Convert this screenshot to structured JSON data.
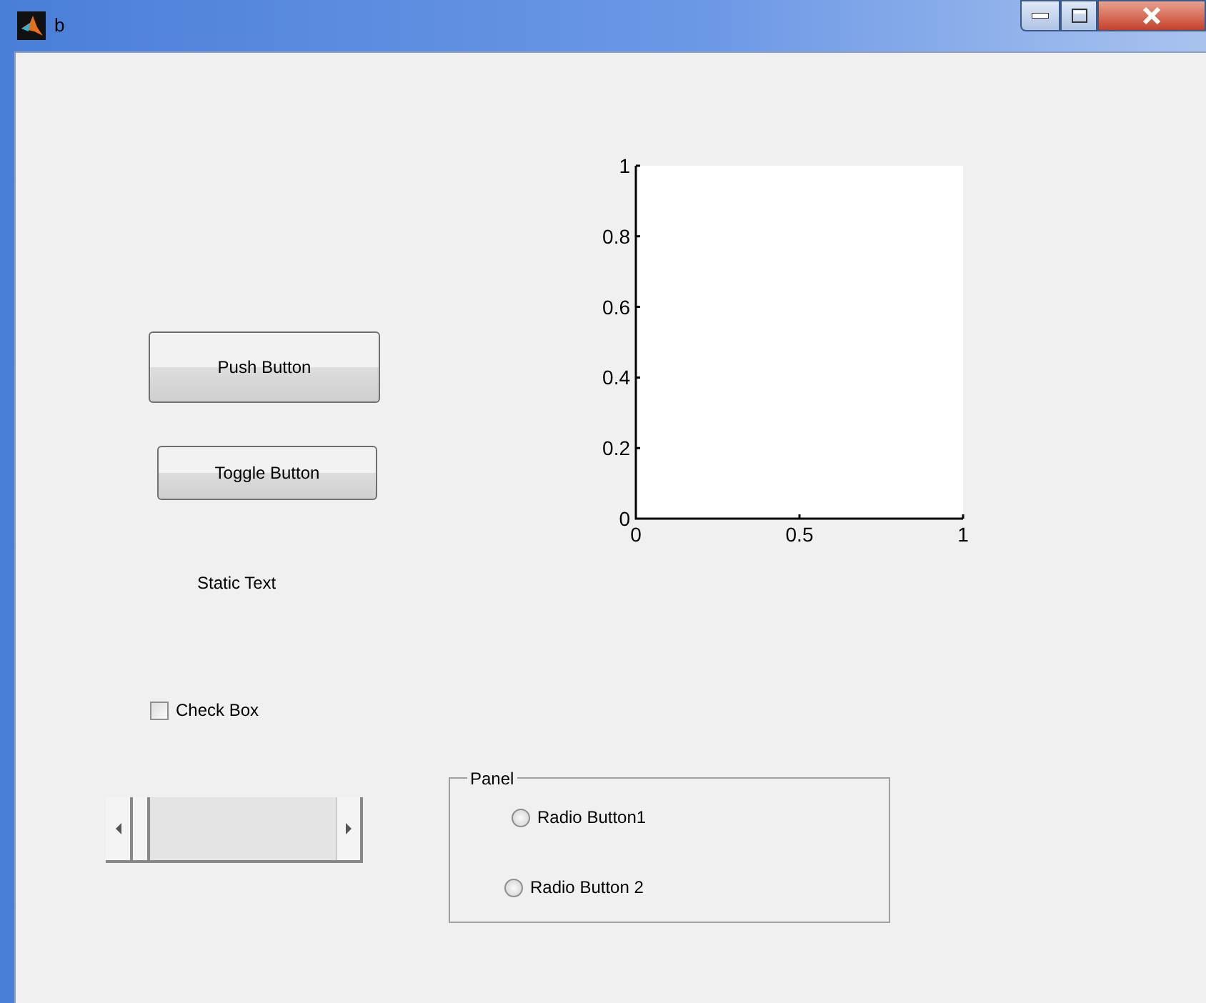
{
  "window": {
    "title": "b"
  },
  "controls": [
    {
      "kind": "pushbutton",
      "label": "Push Button"
    },
    {
      "kind": "togglebutton",
      "label": "Toggle Button",
      "selected": false
    },
    {
      "kind": "text",
      "label": "Static Text"
    },
    {
      "kind": "checkbox",
      "label": "Check Box",
      "checked": false
    },
    {
      "kind": "slider",
      "level": 0
    }
  ],
  "panel": {
    "title": "Panel",
    "radios": [
      {
        "label": "Radio Button1",
        "selected": false
      },
      {
        "label": "Radio Button 2",
        "selected": false
      }
    ]
  },
  "axes": {
    "chart_data": {
      "type": "line",
      "xlim": [
        0,
        1
      ],
      "ylim": [
        0,
        1
      ],
      "xticks": [
        0,
        0.5,
        1
      ],
      "yticks": [
        0,
        0.2,
        0.4,
        0.6,
        0.8,
        1
      ]
    }
  }
}
